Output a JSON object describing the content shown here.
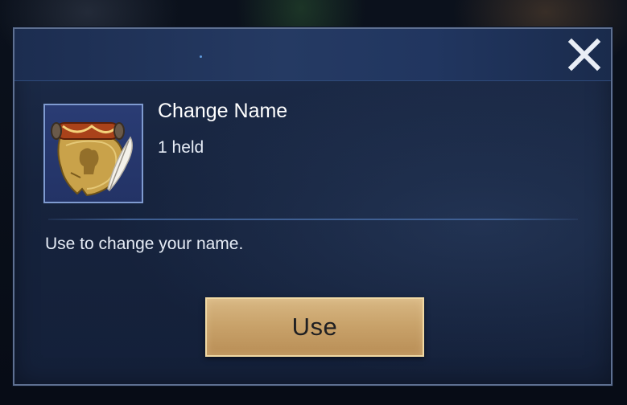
{
  "dialog": {
    "close_icon": "close-icon",
    "item": {
      "icon": "scroll-quill-icon",
      "title": "Change Name",
      "count": "1 held",
      "description": "Use to change your name."
    },
    "use_button_label": "Use"
  },
  "colors": {
    "dialog_bg": "#16233d",
    "header_bg": "#253a63",
    "frame_border": "#7f9bd0",
    "button_gold": "#c9a36b",
    "text": "#ffffff"
  }
}
